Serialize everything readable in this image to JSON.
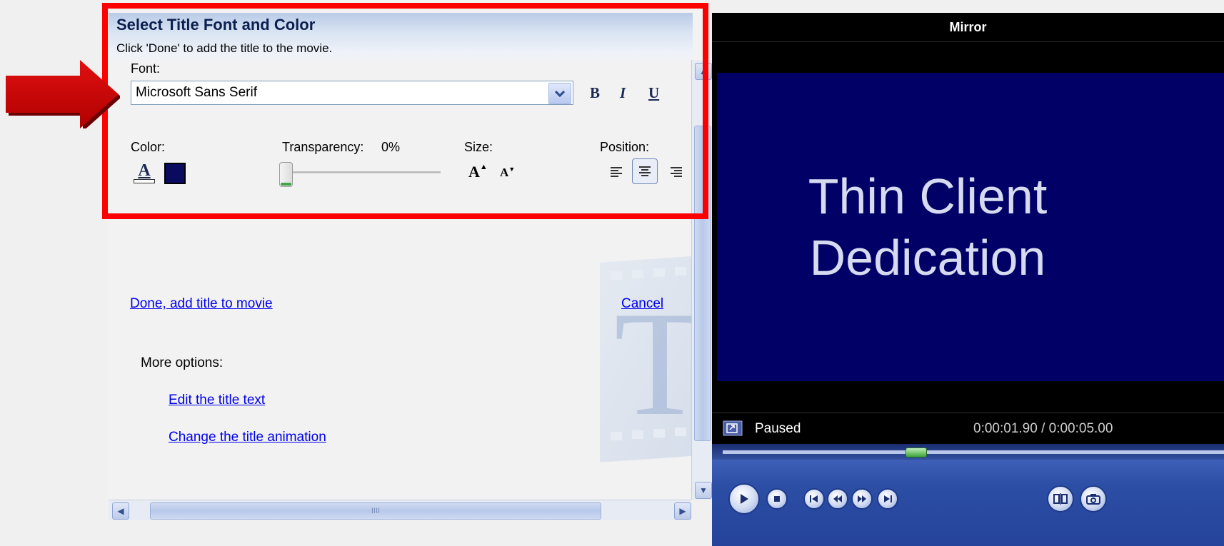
{
  "task_pane": {
    "title": "Select Title Font and Color",
    "subtitle": "Click 'Done' to add the title to the movie.",
    "font_label": "Font:",
    "font_value": "Microsoft Sans Serif",
    "bold_label": "B",
    "italic_label": "I",
    "underline_label": "U",
    "color_label": "Color:",
    "font_color_glyph": "A",
    "background_color": "#0a0a5e",
    "transparency_label": "Transparency:",
    "transparency_value": "0%",
    "transparency_level": 0,
    "size_label": "Size:",
    "increase_size_glyph": "A",
    "decrease_size_glyph": "A",
    "position_label": "Position:",
    "position_selected": "center",
    "done_link": "Done, add title to movie",
    "cancel_link": "Cancel",
    "more_options_label": "More options:",
    "edit_text_link": "Edit the title text",
    "change_animation_link": "Change the title animation",
    "watermark_letter": "T"
  },
  "scrollbar": {
    "grip": "IIII"
  },
  "preview": {
    "title": "Mirror",
    "video_text_line1": "Thin Client",
    "video_text_line2": "Dedication",
    "status": "Paused",
    "time": "0:00:01.90 / 0:00:05.00",
    "seek_progress": 0.38
  },
  "colors": {
    "highlight": "#ff0000",
    "video_bg": "#000066",
    "link": "#0000ee"
  },
  "icons": [
    "red-arrow-icon",
    "dropdown-arrow-icon",
    "align-left-icon",
    "align-center-icon",
    "align-right-icon",
    "fullscreen-icon",
    "play-icon",
    "stop-icon",
    "previous-icon",
    "rewind-icon",
    "forward-icon",
    "next-icon",
    "split-icon",
    "snapshot-icon"
  ]
}
